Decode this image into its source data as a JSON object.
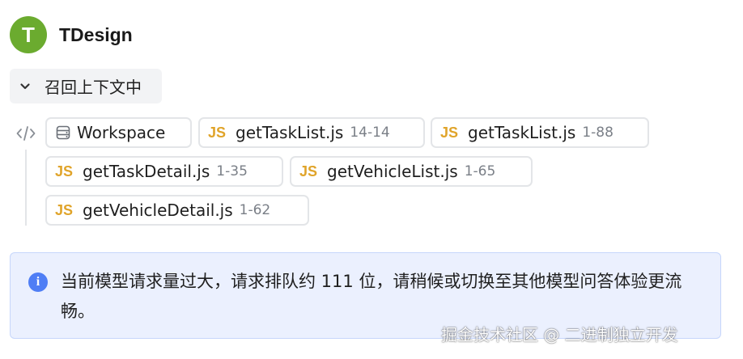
{
  "header": {
    "avatar_letter": "T",
    "app_name": "TDesign"
  },
  "context_toggle": {
    "label": "召回上下文中",
    "icon": "chevron-down-icon"
  },
  "context_chips": {
    "icon": "code-icon",
    "workspace": {
      "icon": "database-icon",
      "label": "Workspace"
    },
    "files": [
      {
        "badge": "JS",
        "name": "getTaskList.js",
        "range": "14-14"
      },
      {
        "badge": "JS",
        "name": "getTaskList.js",
        "range": "1-88"
      },
      {
        "badge": "JS",
        "name": "getTaskDetail.js",
        "range": "1-35"
      },
      {
        "badge": "JS",
        "name": "getVehicleList.js",
        "range": "1-65"
      },
      {
        "badge": "JS",
        "name": "getVehicleDetail.js",
        "range": "1-62"
      }
    ]
  },
  "notice": {
    "icon": "info-icon",
    "icon_glyph": "i",
    "text": "当前模型请求量过大，请求排队约 111 位，请稍候或切换至其他模型问答体验更流畅。"
  },
  "watermark": "掘金技术社区 @ 二进制独立开发",
  "colors": {
    "avatar": "#6bab2f",
    "js_badge": "#e0a42a",
    "notice_bg": "#ebf0fe",
    "info_icon": "#4f7ef5"
  }
}
